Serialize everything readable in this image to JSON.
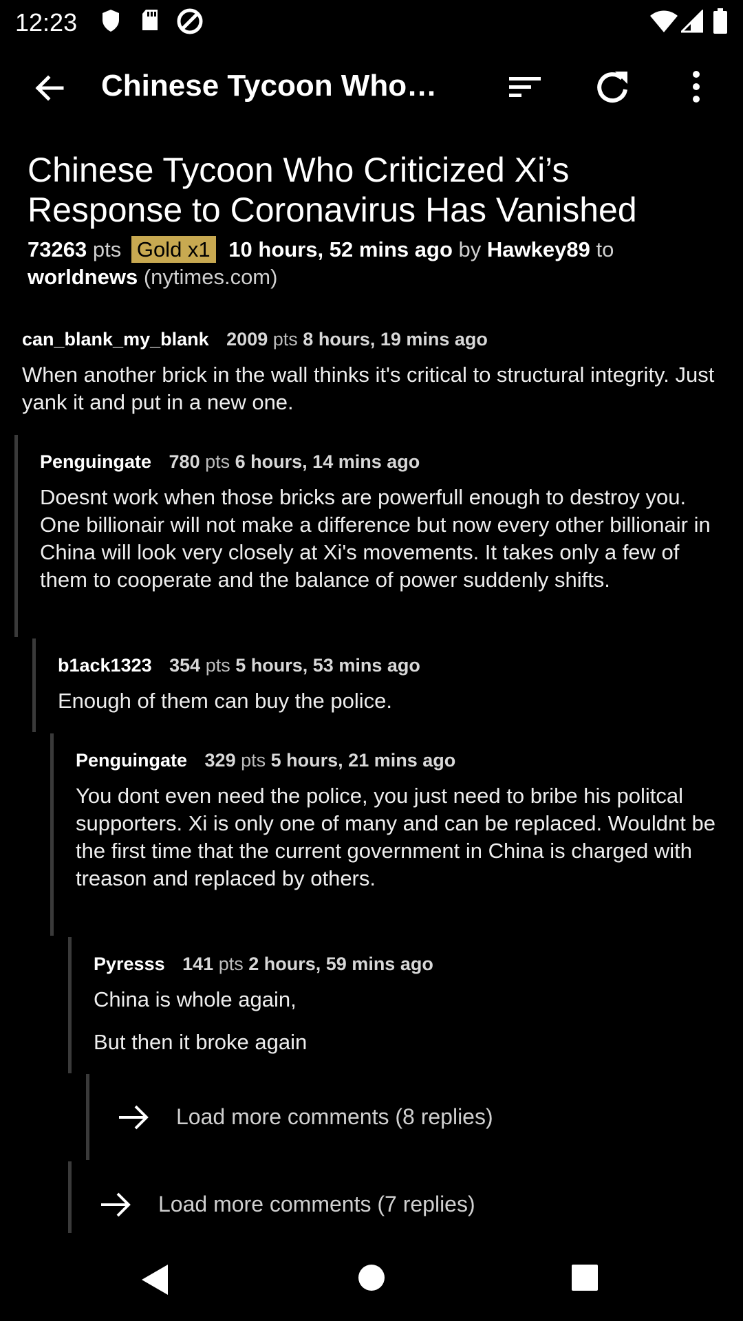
{
  "status_bar": {
    "time": "12:23",
    "icons_left": [
      "shield-icon",
      "sd-card-icon",
      "at-sign-icon"
    ],
    "icons_right": [
      "wifi-icon",
      "cell-signal-icon",
      "battery-icon"
    ]
  },
  "app_bar": {
    "title": "Chinese Tycoon Who…",
    "icons": [
      "back-arrow-icon",
      "sort-icon",
      "refresh-icon",
      "more-vert-icon"
    ]
  },
  "post": {
    "title": "Chinese Tycoon Who Criticized Xi’s Response to Coronavirus Has Vanished",
    "score": "73263",
    "score_unit": "pts",
    "gold": "Gold x1",
    "age": "10 hours, 52 mins ago",
    "by_label": "by",
    "author": "Hawkey89",
    "to_label": "to",
    "subreddit": "worldnews",
    "domain": "(nytimes.com)"
  },
  "comments": [
    {
      "author": "can_blank_my_blank",
      "score": "2009",
      "unit": "pts",
      "age": "8 hours, 19 mins ago",
      "body": [
        "When another brick in the wall thinks it's critical to structural integrity. Just yank it and put in a new one."
      ]
    },
    {
      "author": "Penguingate",
      "score": "780",
      "unit": "pts",
      "age": "6 hours, 14 mins ago",
      "body": [
        "Doesnt work when those bricks are powerfull enough to destroy you. One billionair will not make a difference but now every other billionair in China will look very closely at Xi's movements. It takes only a few of them to cooperate and the balance of power suddenly shifts."
      ]
    },
    {
      "author": "b1ack1323",
      "score": "354",
      "unit": "pts",
      "age": "5 hours, 53 mins ago",
      "body": [
        "Enough of them can buy the police."
      ]
    },
    {
      "author": "Penguingate",
      "score": "329",
      "unit": "pts",
      "age": "5 hours, 21 mins ago",
      "body": [
        "You dont even need the police, you just need to bribe his politcal supporters. Xi is only one of many and can be replaced. Wouldnt be the first time that the current government in China is charged with treason and replaced by others."
      ]
    },
    {
      "author": "Pyresss",
      "score": "141",
      "unit": "pts",
      "age": "2 hours, 59 mins ago",
      "body": [
        "China is whole again,",
        "But then it broke again"
      ]
    }
  ],
  "load_more": [
    {
      "label": "Load more comments (8 replies)"
    },
    {
      "label": "Load more comments (7 replies)"
    }
  ],
  "nav_bar": {
    "icons": [
      "nav-back-icon",
      "nav-home-icon",
      "nav-recents-icon"
    ]
  }
}
